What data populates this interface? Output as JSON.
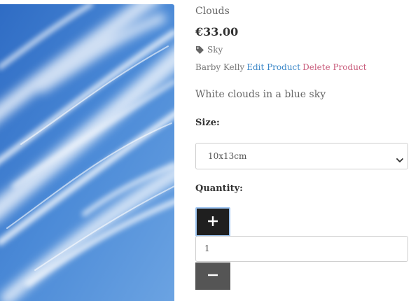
{
  "product": {
    "title": "Clouds",
    "price": "€33.00",
    "category": "Sky",
    "owner": "Barby Kelly",
    "edit_label": "Edit Product",
    "delete_label": "Delete Product",
    "description": "White clouds in a blue sky"
  },
  "size": {
    "label": "Size:",
    "selected": "10x13cm"
  },
  "quantity": {
    "label": "Quantity:",
    "value": "1",
    "plus_label": "+",
    "minus_label": "−"
  },
  "icons": {
    "category": "tag-icon",
    "select": "chevron-down-icon"
  },
  "colors": {
    "edit_link": "#3b87c8",
    "delete_link": "#c85a7a",
    "plus_button": "#1f1f1f",
    "minus_button": "#555555",
    "sky": "#3f7fce"
  }
}
